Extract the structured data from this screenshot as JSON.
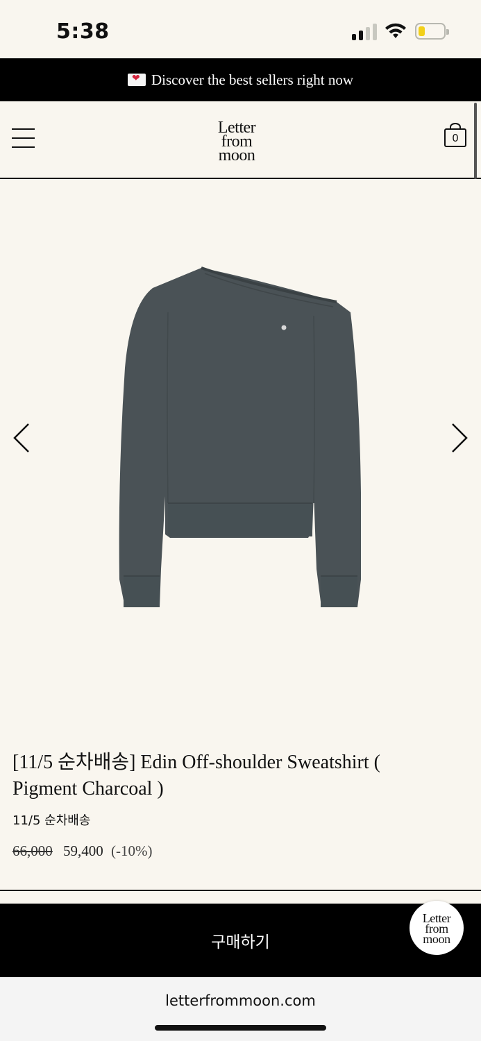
{
  "status": {
    "time": "5:38"
  },
  "promo": {
    "icon": "heart-letter-icon",
    "text": "Discover the best sellers right now"
  },
  "header": {
    "logo_line1": "Letter",
    "logo_line2": "from",
    "logo_line3": "moon",
    "cart_count": "0"
  },
  "product": {
    "title": "[11/5 순차배송] Edin Off-shoulder Sweatshirt ( Pigment Charcoal )",
    "subtitle": "11/5 순차배송",
    "price_original": "66,000",
    "price_sale": "59,400",
    "discount": "(-10%)",
    "image_color": "#4a5256"
  },
  "buy_bar": {
    "label": "구매하기"
  },
  "floating_logo": {
    "line1": "Letter",
    "line2": "from",
    "line3": "moon"
  },
  "browser": {
    "url": "letterfrommoon.com"
  }
}
